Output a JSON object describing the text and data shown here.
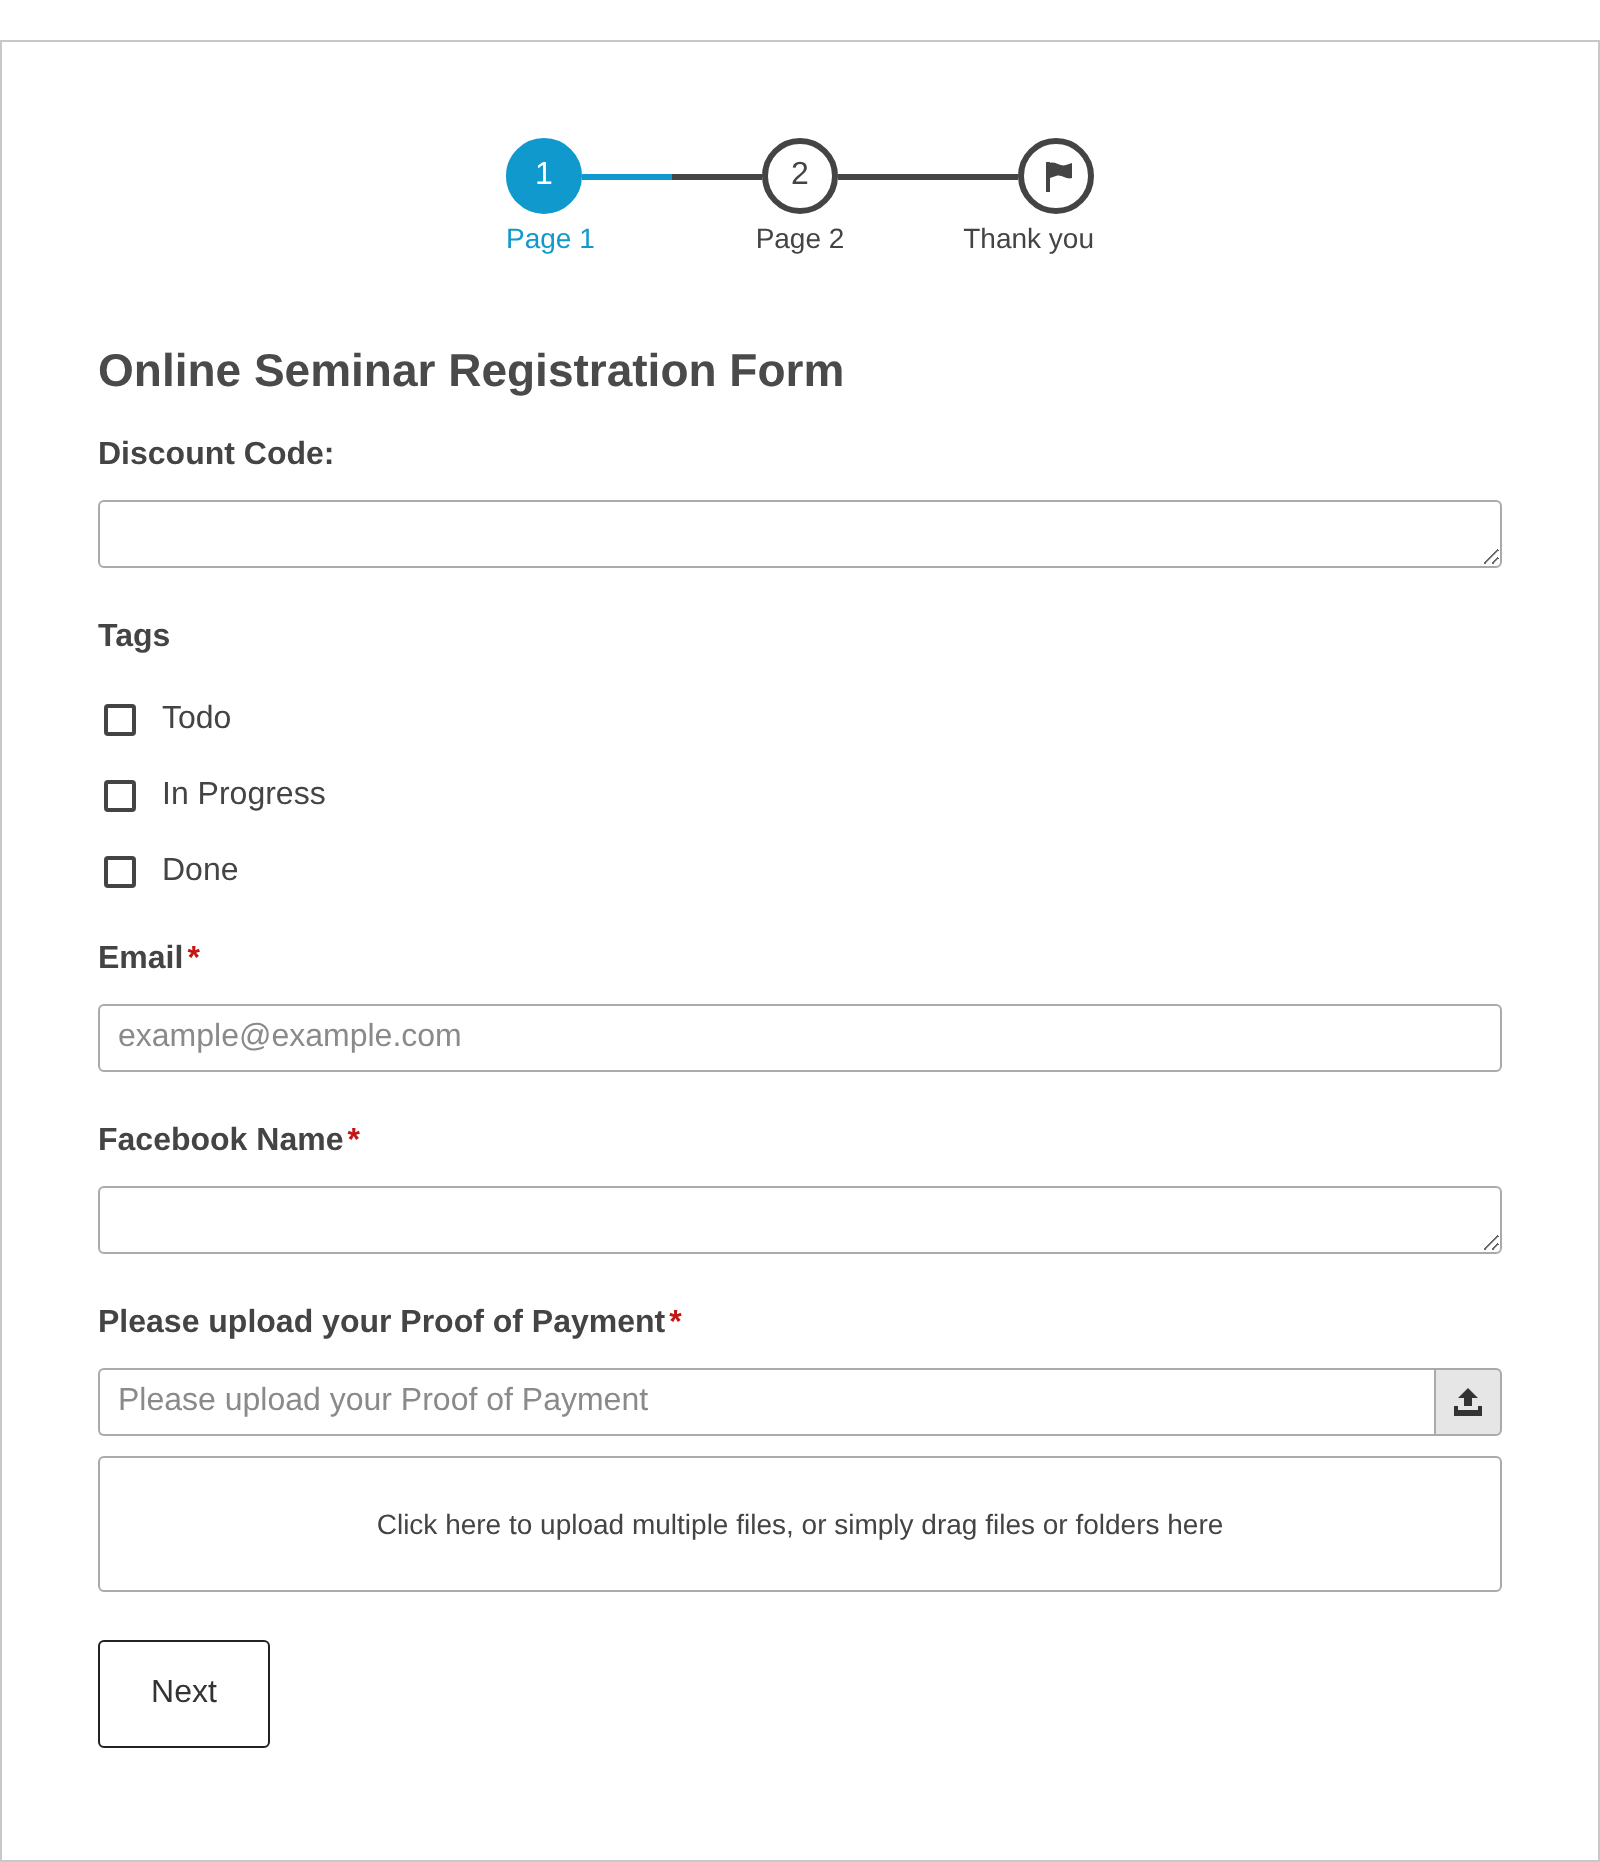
{
  "steps": [
    {
      "kind": "number",
      "number": "1",
      "label": "Page 1",
      "selected": true
    },
    {
      "kind": "number",
      "number": "2",
      "label": "Page 2",
      "selected": false
    },
    {
      "kind": "flag",
      "label": "Thank you",
      "selected": false
    }
  ],
  "title": "Online Seminar Registration Form",
  "fields": [
    {
      "kind": "textarea",
      "label": "Discount Code:"
    },
    {
      "kind": "checkboxes",
      "label": "Tags",
      "options": [
        {
          "label": "Todo",
          "checked": false
        },
        {
          "label": "In Progress",
          "checked": false
        },
        {
          "label": "Done",
          "checked": false
        }
      ]
    },
    {
      "kind": "input",
      "label": "Email",
      "required_mark": "*",
      "placeholder": "example@example.com"
    },
    {
      "kind": "textarea",
      "label": "Facebook Name",
      "required_mark": "*"
    },
    {
      "kind": "file",
      "label": "Please upload your Proof of Payment",
      "required_mark": "*",
      "placeholder": "Please upload your Proof of Payment",
      "drop_zone": "Click here to upload multiple files, or simply drag files or folders here"
    }
  ],
  "next_button": "Next"
}
